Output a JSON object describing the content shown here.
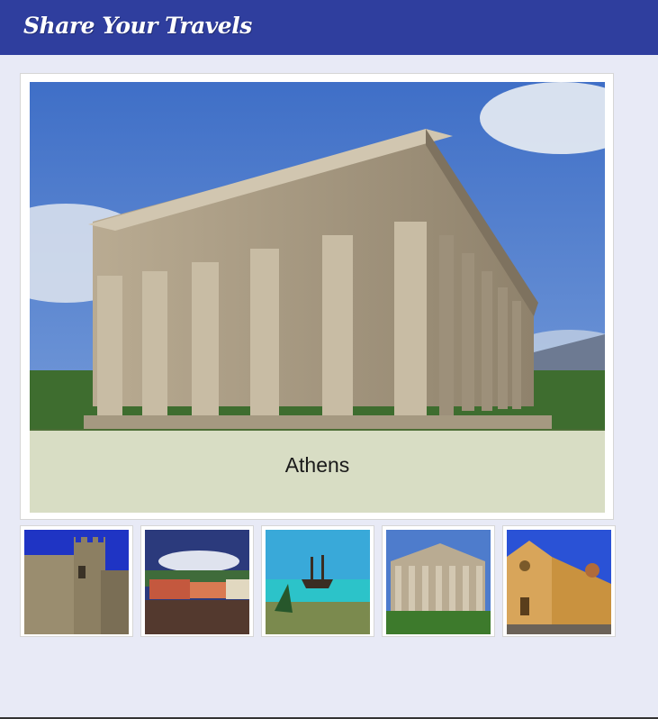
{
  "header": {
    "title": "Share Your Travels"
  },
  "featured": {
    "caption": "Athens",
    "image": "temple-of-hephaestus-photo"
  },
  "thumbnails": [
    {
      "image": "castle-tower-photo"
    },
    {
      "image": "waterfront-town-photo"
    },
    {
      "image": "pirate-ship-beach-photo"
    },
    {
      "image": "greek-temple-photo"
    },
    {
      "image": "church-facade-photo"
    }
  ],
  "colors": {
    "header": "#2f3e9e",
    "background": "#e8eaf6"
  }
}
